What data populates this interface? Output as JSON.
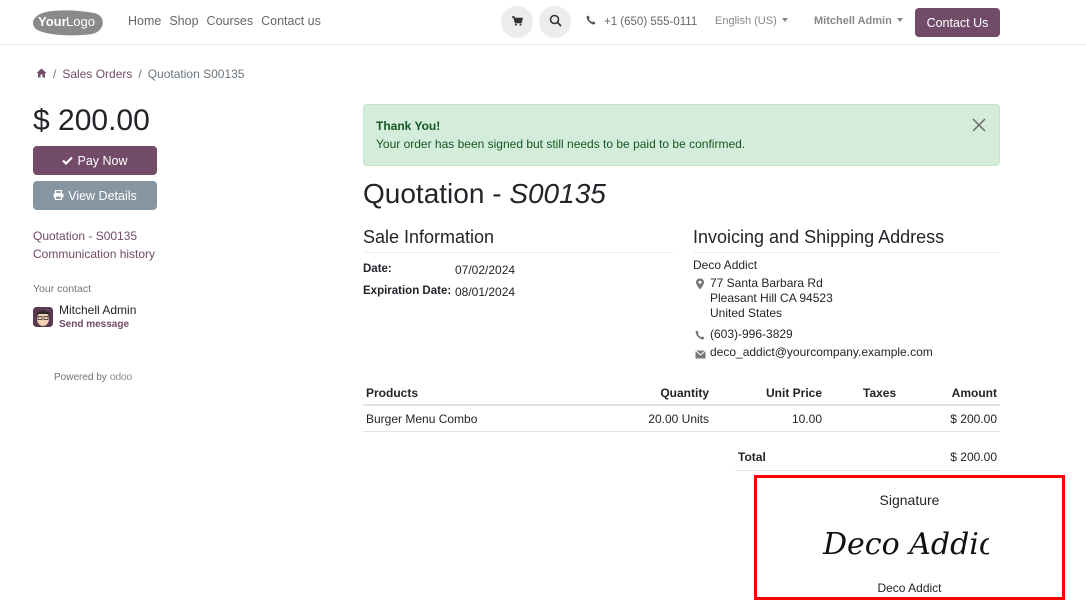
{
  "header": {
    "logo_text_bold": "Your",
    "logo_text_light": "Logo",
    "nav": [
      "Home",
      "Shop",
      "Courses",
      "Contact us"
    ],
    "cart_icon": "cart-icon",
    "search_icon": "search-icon",
    "phone": "+1 (650) 555-0111",
    "language": "English (US)",
    "user": "Mitchell Admin",
    "contact_button": "Contact Us",
    "brand_color": "#714b67"
  },
  "breadcrumb": {
    "home_icon": "home-icon",
    "items": [
      "Sales Orders",
      "Quotation S00135"
    ]
  },
  "sidebar": {
    "amount": "$ 200.00",
    "pay_now": "Pay Now",
    "view_details": "View Details",
    "links": [
      "Quotation - S00135",
      "Communication history"
    ],
    "contact_label": "Your contact",
    "contact_name": "Mitchell Admin",
    "send_message": "Send message",
    "powered_by": "Powered by",
    "powered_brand": "odoo"
  },
  "alert": {
    "title": "Thank You!",
    "text": "Your order has been signed but still needs to be paid to be confirmed.",
    "color": "#155724",
    "background": "#d4edda"
  },
  "document": {
    "title_prefix": "Quotation - ",
    "title_ref": "S00135",
    "sale_info": {
      "heading": "Sale Information",
      "date_label": "Date:",
      "date_value": "07/02/2024",
      "expiration_label": "Expiration Date:",
      "expiration_value": "08/01/2024"
    },
    "address": {
      "heading": "Invoicing and Shipping Address",
      "name": "Deco Addict",
      "street": "77 Santa Barbara Rd",
      "city": "Pleasant Hill CA 94523",
      "country": "United States",
      "phone": "(603)-996-3829",
      "email": "deco_addict@yourcompany.example.com"
    },
    "table": {
      "headers": [
        "Products",
        "Quantity",
        "Unit Price",
        "Taxes",
        "Amount"
      ],
      "rows": [
        [
          "Burger Menu Combo",
          "20.00 Units",
          "10.00",
          "",
          "$ 200.00"
        ]
      ],
      "total_label": "Total",
      "total_value": "$ 200.00"
    },
    "signature": {
      "title": "Signature",
      "signed_text": "Deco Addict",
      "name": "Deco Addict",
      "highlight_color": "#ff0000"
    }
  }
}
